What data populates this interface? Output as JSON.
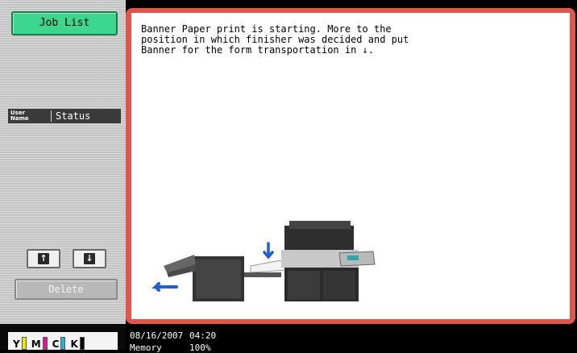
{
  "sidebar": {
    "job_list_label": "Job List",
    "table_headers": {
      "user_name": "User\nName",
      "status": "Status"
    },
    "scroll_up_glyph": "↑",
    "scroll_down_glyph": "↓",
    "delete_label": "Delete"
  },
  "toner": [
    {
      "label": "Y",
      "color": "#f2e600"
    },
    {
      "label": "M",
      "color": "#e5149b"
    },
    {
      "label": "C",
      "color": "#22b7d8"
    },
    {
      "label": "K",
      "color": "#000000"
    }
  ],
  "main": {
    "message": "Banner Paper print is starting. More to the\nposition in which finisher was decided and put\nBanner for the form transportation in ↓."
  },
  "status_bar": {
    "date": "08/16/2007",
    "time": "04:20",
    "memory_label": "Memory",
    "memory_value": "100%"
  },
  "colors": {
    "frame": "#e2554a",
    "job_list_button": "#3cd68c",
    "illustration_arrow": "#1f5fd6"
  }
}
